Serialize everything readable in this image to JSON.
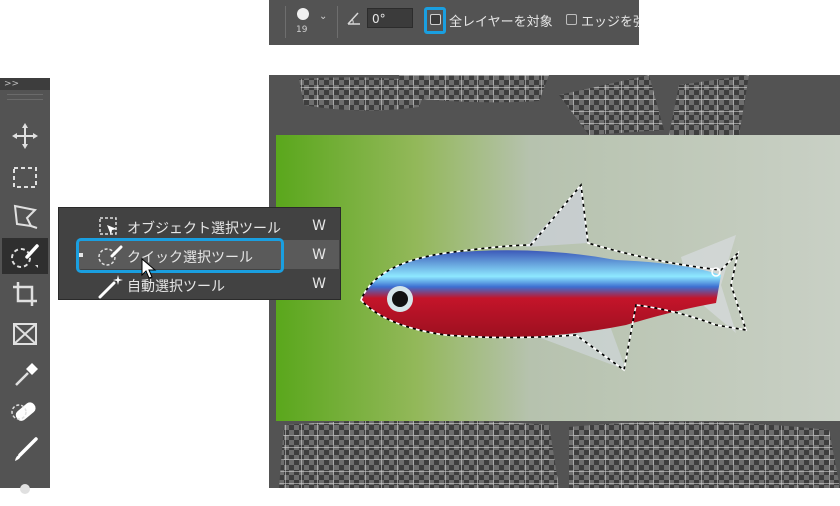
{
  "options_bar": {
    "brush_size": "19",
    "angle_value": "0°",
    "sample_all_layers_label": "全レイヤーを対象",
    "enhance_edge_label": "エッジを強"
  },
  "toolbar": {
    "collapse_label": ">>",
    "tools": [
      "move-tool-icon",
      "marquee-tool-icon",
      "lasso-tool-icon",
      "quick-selection-tool-icon",
      "crop-tool-icon",
      "frame-tool-icon",
      "eyedropper-tool-icon",
      "healing-brush-tool-icon",
      "brush-tool-icon"
    ]
  },
  "flyout": {
    "items": [
      {
        "label": "オブジェクト選択ツール",
        "shortcut": "W"
      },
      {
        "label": "クイック選択ツール",
        "shortcut": "W"
      },
      {
        "label": "自動選択ツール",
        "shortcut": "W"
      }
    ]
  },
  "colors": {
    "highlight": "#1a9fe0",
    "panel": "#535353",
    "menu": "#424242"
  }
}
